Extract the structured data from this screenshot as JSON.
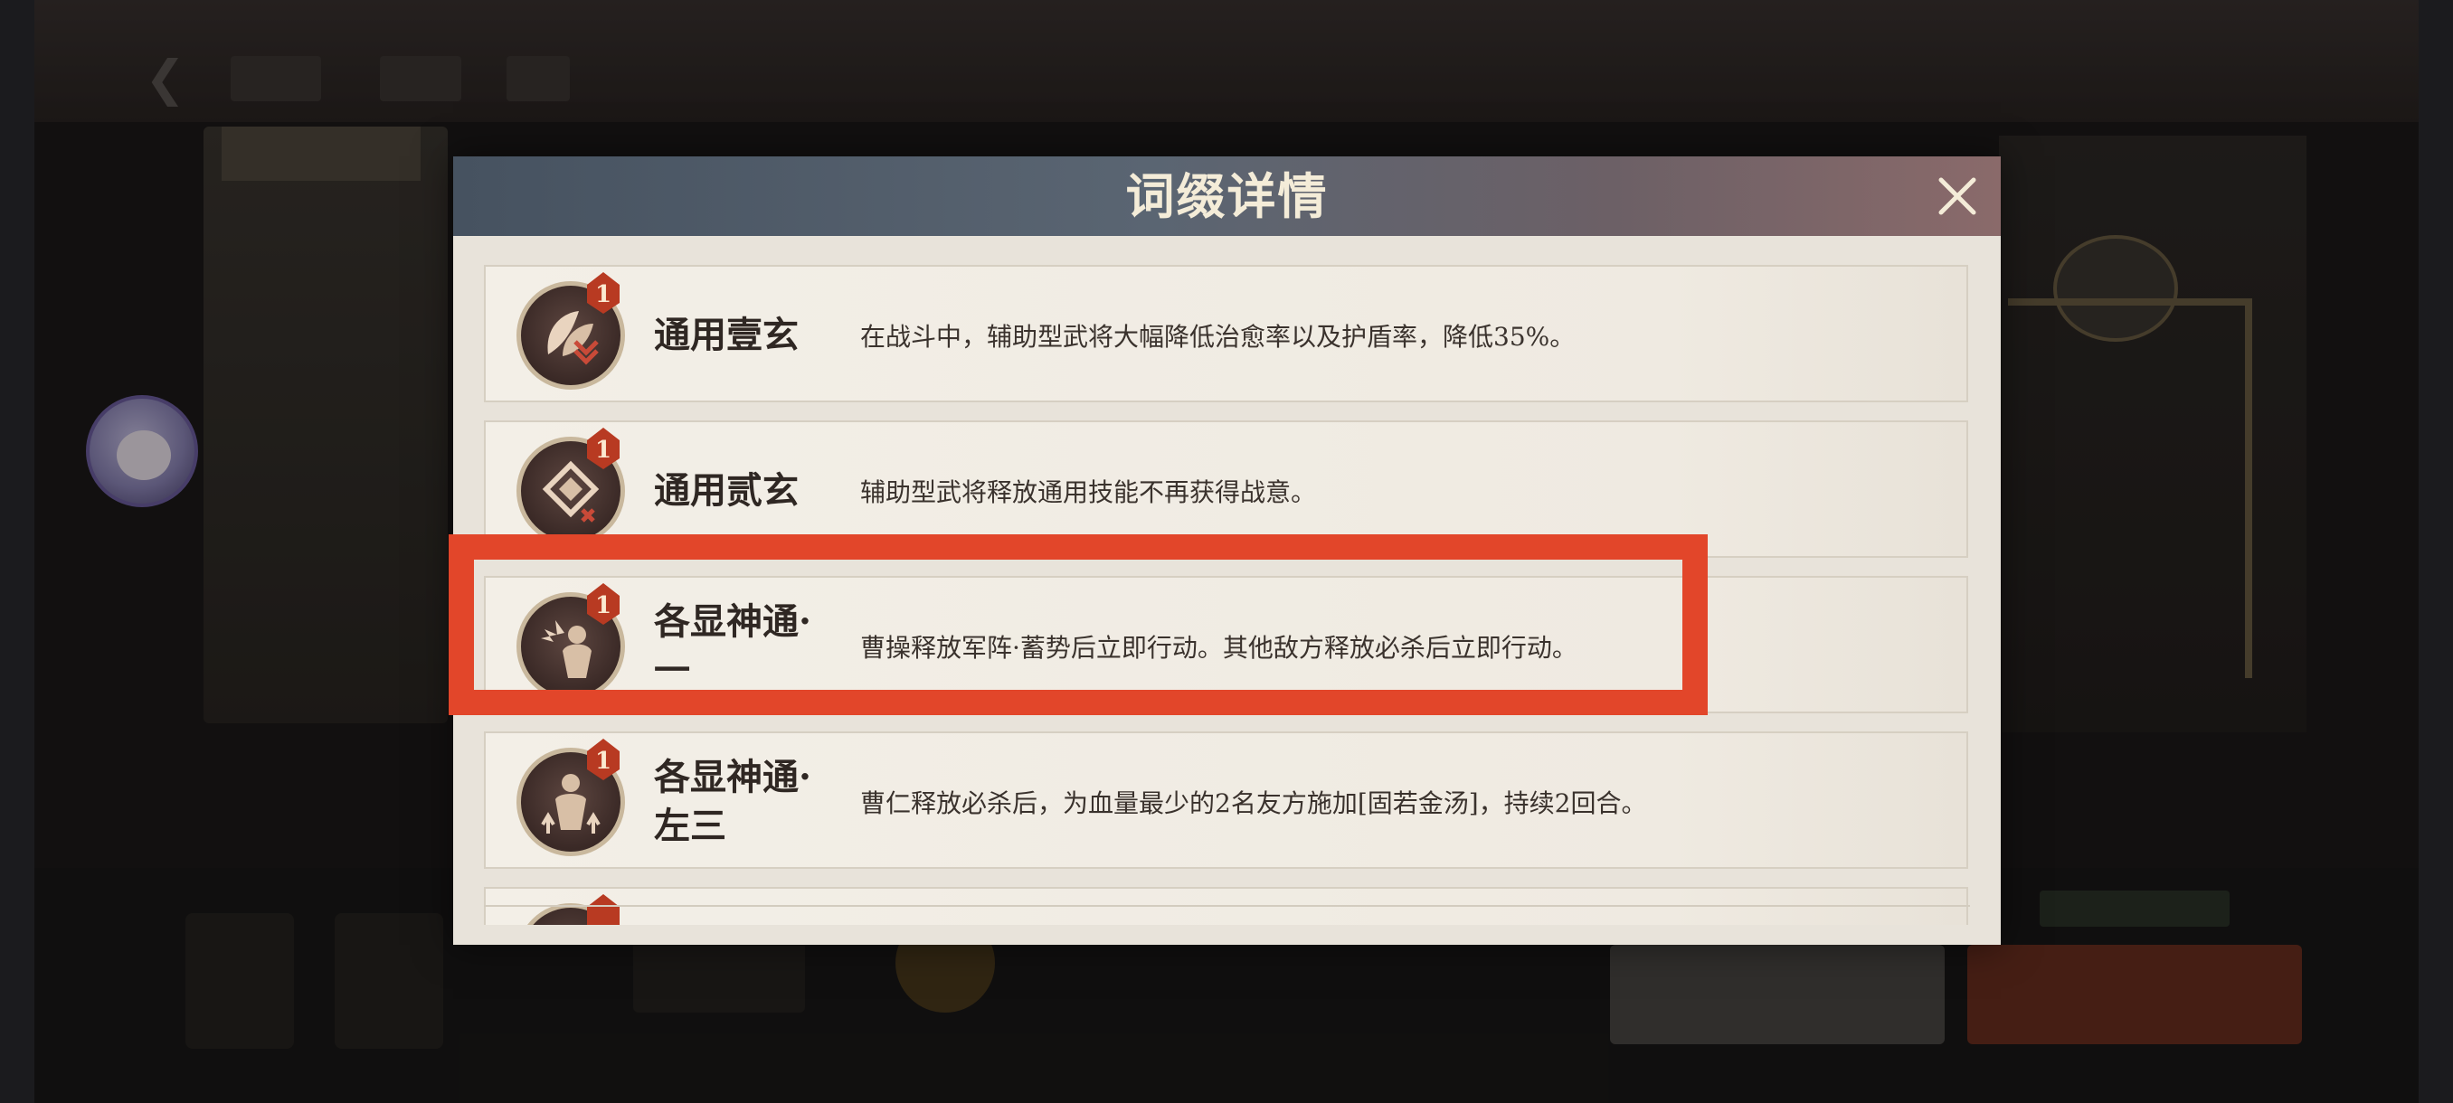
{
  "modal": {
    "title": "词缀详情",
    "close_icon": "close-icon"
  },
  "affixes": [
    {
      "name": "通用壹玄",
      "level": "1",
      "description": "在战斗中，辅助型武将大幅降低治愈率以及护盾率，降低35%。",
      "icon": "leaf-down-icon"
    },
    {
      "name": "通用贰玄",
      "level": "1",
      "description": "辅助型武将释放通用技能不再获得战意。",
      "icon": "diamond-cross-icon"
    },
    {
      "name": "各显神通·一",
      "level": "1",
      "description": "曹操释放军阵·蓄势后立即行动。其他敌方释放必杀后立即行动。",
      "icon": "warrior-burst-icon"
    },
    {
      "name": "各显神通·左三",
      "level": "1",
      "description": "曹仁释放必杀后，为血量最少的2名友方施加[固若金汤]，持续2回合。",
      "icon": "warrior-buff-icon"
    }
  ],
  "highlight": {
    "color": "#e2462a",
    "target_row": 3
  },
  "colors": {
    "header_start": "#465260",
    "header_end": "#8a6a6a",
    "title": "#f4ecd8",
    "badge": "#b83a22"
  }
}
